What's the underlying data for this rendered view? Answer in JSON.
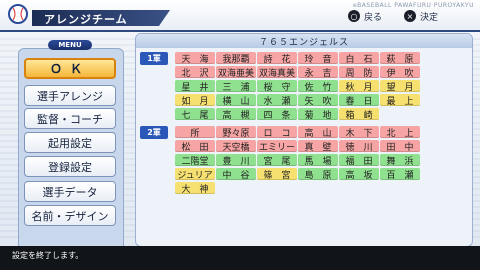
{
  "header": {
    "title": "アレンジチーム",
    "brand": "eBASEBALL PAWAFURU PUROYAKYU",
    "back_icon": "circle-icon",
    "back_label": "戻る",
    "ok_icon": "cross-icon",
    "ok_label": "決定",
    "circle_glyph": "○",
    "cross_glyph": "×"
  },
  "menu": {
    "heading": "MENU",
    "items": [
      "ＯＫ",
      "選手アレンジ",
      "監督・コーチ",
      "起用設定",
      "登録設定",
      "選手データ",
      "名前・デザイン"
    ],
    "selected_index": 0
  },
  "roster": {
    "team_name": "７６５エンジェルス",
    "group1_label": "1軍",
    "group2_label": "2軍",
    "group1": [
      [
        {
          "t": "天　海",
          "c": "red"
        },
        {
          "t": "我那覇",
          "c": "red"
        },
        {
          "t": "詩　花",
          "c": "red"
        },
        {
          "t": "玲　音",
          "c": "red"
        },
        {
          "t": "白　石",
          "c": "red"
        },
        {
          "t": "萩　原",
          "c": "red"
        }
      ],
      [
        {
          "t": "北　沢",
          "c": "red"
        },
        {
          "t": "双海亜美",
          "c": "red"
        },
        {
          "t": "双海真美",
          "c": "red"
        },
        {
          "t": "永　吉",
          "c": "red"
        },
        {
          "t": "周　防",
          "c": "red"
        },
        {
          "t": "伊　吹",
          "c": "red"
        }
      ],
      [
        {
          "t": "星　井",
          "c": "green"
        },
        {
          "t": "三　浦",
          "c": "green"
        },
        {
          "t": "桜　守",
          "c": "green"
        },
        {
          "t": "佐　竹",
          "c": "green"
        },
        {
          "t": "秋　月",
          "c": "yellow"
        },
        {
          "t": "望　月",
          "c": "yellow"
        }
      ],
      [
        {
          "t": "如　月",
          "c": "yellow"
        },
        {
          "t": "横　山",
          "c": "green"
        },
        {
          "t": "水　瀬",
          "c": "green"
        },
        {
          "t": "矢　吹",
          "c": "green"
        },
        {
          "t": "春　日",
          "c": "green"
        },
        {
          "t": "最　上",
          "c": "yellow"
        }
      ],
      [
        {
          "t": "七　尾",
          "c": "green"
        },
        {
          "t": "高　槻",
          "c": "green"
        },
        {
          "t": "四　条",
          "c": "green"
        },
        {
          "t": "菊　地",
          "c": "green"
        },
        {
          "t": "箱　崎",
          "c": "yellow"
        },
        {
          "t": "",
          "c": "empty"
        }
      ]
    ],
    "group2": [
      [
        {
          "t": "所",
          "c": "red"
        },
        {
          "t": "野々原",
          "c": "red"
        },
        {
          "t": "ロ　コ",
          "c": "red"
        },
        {
          "t": "高　山",
          "c": "red"
        },
        {
          "t": "木　下",
          "c": "red"
        },
        {
          "t": "北　上",
          "c": "red"
        }
      ],
      [
        {
          "t": "松　田",
          "c": "red"
        },
        {
          "t": "天空橋",
          "c": "red"
        },
        {
          "t": "エミリー",
          "c": "red"
        },
        {
          "t": "真　壁",
          "c": "red"
        },
        {
          "t": "徳　川",
          "c": "red"
        },
        {
          "t": "田　中",
          "c": "red"
        }
      ],
      [
        {
          "t": "二階堂",
          "c": "green"
        },
        {
          "t": "豊　川",
          "c": "green"
        },
        {
          "t": "宮　尾",
          "c": "green"
        },
        {
          "t": "馬　場",
          "c": "green"
        },
        {
          "t": "福　田",
          "c": "green"
        },
        {
          "t": "舞　浜",
          "c": "green"
        }
      ],
      [
        {
          "t": "ジュリア",
          "c": "yellow"
        },
        {
          "t": "中　谷",
          "c": "green"
        },
        {
          "t": "篠　宮",
          "c": "yellow"
        },
        {
          "t": "島　原",
          "c": "green"
        },
        {
          "t": "高　坂",
          "c": "green"
        },
        {
          "t": "百　瀬",
          "c": "green"
        }
      ],
      [
        {
          "t": "大　神",
          "c": "yellow"
        },
        {
          "t": "",
          "c": "empty"
        },
        {
          "t": "",
          "c": "empty"
        },
        {
          "t": "",
          "c": "empty"
        },
        {
          "t": "",
          "c": "empty"
        },
        {
          "t": "",
          "c": "empty"
        }
      ]
    ]
  },
  "footer": {
    "message": "設定を終了します。"
  },
  "colors": {
    "red": "#f7a4a4",
    "green": "#8fe08f",
    "yellow": "#f5e070",
    "accent": "#2a57b8"
  }
}
